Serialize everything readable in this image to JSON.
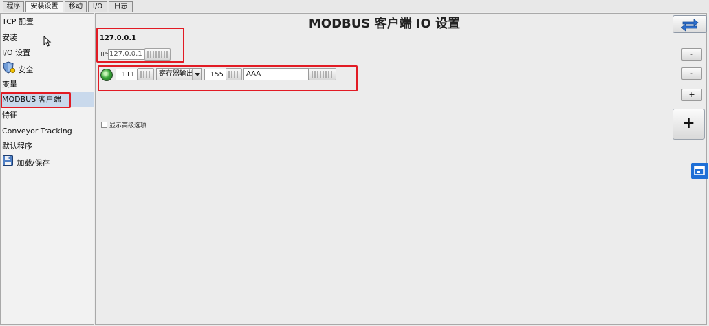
{
  "tabs": [
    "程序",
    "安装设置",
    "移动",
    "I/O",
    "日志"
  ],
  "active_tab": "安装设置",
  "sidebar": {
    "items": [
      {
        "label": "TCP 配置"
      },
      {
        "label": "安装"
      },
      {
        "label": "I/O 设置"
      },
      {
        "label": "安全",
        "icon": "shield-icon"
      },
      {
        "label": "变量"
      },
      {
        "label": "MODBUS 客户端",
        "selected": true
      },
      {
        "label": "特征"
      },
      {
        "label": "Conveyor Tracking"
      },
      {
        "label": "默认程序"
      },
      {
        "label": "加载/保存",
        "icon": "floppy-disk-icon"
      }
    ]
  },
  "main": {
    "title": "MODBUS 客户端 IO 设置",
    "server": {
      "header": "127.0.0.1",
      "ip_prefix": "IP:",
      "ip_value": "127.0.0.1",
      "remove_server_label": "-"
    },
    "signal": {
      "status": "connected",
      "status_color": "#3aa63a",
      "address": "111",
      "type": "寄存器输出",
      "value": "155",
      "name": "AAA",
      "remove_label": "-",
      "add_label": "+"
    },
    "advanced_label": "显示高级选项",
    "advanced_checked": false,
    "add_server_label": "+"
  },
  "colors": {
    "highlight_box": "#e21b24",
    "selected_nav": "#c9d9ec",
    "edge_widget": "#1e6fd6"
  }
}
